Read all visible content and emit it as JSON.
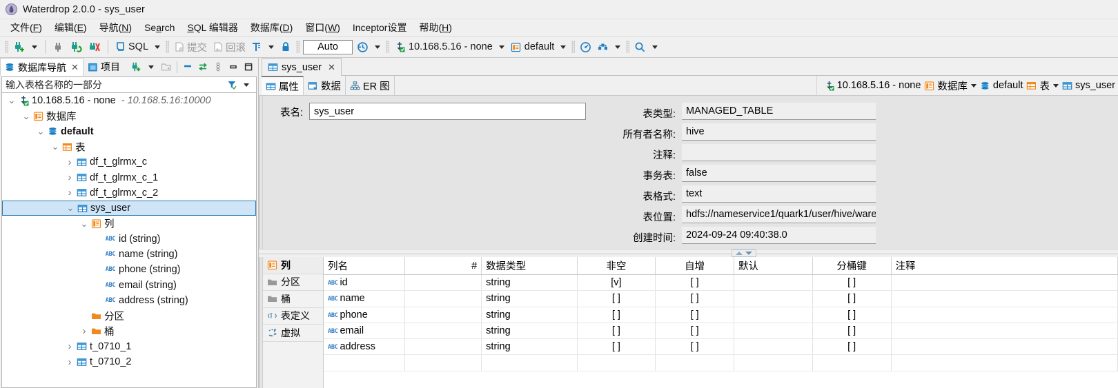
{
  "window": {
    "title": "Waterdrop 2.0.0 - sys_user",
    "icon": "waterdrop-icon",
    "minimize_label": "—",
    "maximize_label": "▣"
  },
  "menubar": {
    "items": [
      {
        "text": "文件(F)",
        "mnemonic": "F"
      },
      {
        "text": "编辑(E)",
        "mnemonic": "E"
      },
      {
        "text": "导航(N)",
        "mnemonic": "N"
      },
      {
        "text": "Search",
        "mnemonic": "a"
      },
      {
        "text": "SQL 编辑器",
        "mnemonic": "S"
      },
      {
        "text": "数据库(D)",
        "mnemonic": "D"
      },
      {
        "text": "窗口(W)",
        "mnemonic": "W"
      },
      {
        "text": "Inceptor设置",
        "mnemonic": ""
      },
      {
        "text": "帮助(H)",
        "mnemonic": "H"
      }
    ]
  },
  "toolbar": {
    "new_connection_label": "new-connection",
    "disconnect_label": "disconnect",
    "reconnect_label": "reconnect",
    "invalidate_label": "invalidate",
    "sql_label": "SQL",
    "commit_label": "提交",
    "rollback_label": "回滚",
    "transaction_mode_label": "transaction-mode",
    "lock_label": "lock",
    "auto_value": "Auto",
    "history_label": "history",
    "connection_value": "10.168.5.16 - none",
    "schema_value": "default",
    "dashboard_label": "dashboard",
    "tools_label": "tools",
    "search_label": "search"
  },
  "left_panel": {
    "tabs": [
      {
        "label": "数据库导航",
        "icon": "database-navigator-icon",
        "active": true,
        "closable": true
      },
      {
        "label": "项目",
        "icon": "project-icon",
        "active": false,
        "closable": false
      }
    ],
    "tools": [
      "new-connection-icon",
      "chevron-down-icon",
      "new-folder-icon",
      "collapse-all-icon",
      "link-editor-icon",
      "menu-icon",
      "minimize-icon",
      "maximize-icon"
    ],
    "filter": {
      "placeholder": "输入表格名称的一部分",
      "value": "",
      "filter_icon": "filter-icon",
      "chevron": "chevron-down-icon"
    },
    "tree": [
      {
        "indent": 0,
        "twist": "v",
        "icon": "connection-icon",
        "label": "10.168.5.16 - none",
        "sub": "10.168.5.16:10000",
        "bold": false,
        "selected": false
      },
      {
        "indent": 1,
        "twist": "v",
        "icon": "folder-db-icon",
        "label": "数据库",
        "sub": "",
        "bold": false,
        "selected": false
      },
      {
        "indent": 2,
        "twist": "v",
        "icon": "schema-icon",
        "label": "default",
        "sub": "",
        "bold": true,
        "selected": false
      },
      {
        "indent": 3,
        "twist": "v",
        "icon": "tables-folder-icon",
        "label": "表",
        "sub": "",
        "bold": false,
        "selected": false
      },
      {
        "indent": 4,
        "twist": ">",
        "icon": "table-icon",
        "label": "df_t_glrmx_c",
        "sub": "",
        "bold": false,
        "selected": false
      },
      {
        "indent": 4,
        "twist": ">",
        "icon": "table-icon",
        "label": "df_t_glrmx_c_1",
        "sub": "",
        "bold": false,
        "selected": false
      },
      {
        "indent": 4,
        "twist": ">",
        "icon": "table-icon",
        "label": "df_t_glrmx_c_2",
        "sub": "",
        "bold": false,
        "selected": false
      },
      {
        "indent": 4,
        "twist": "v",
        "icon": "table-icon",
        "label": "sys_user",
        "sub": "",
        "bold": false,
        "selected": true
      },
      {
        "indent": 5,
        "twist": "v",
        "icon": "columns-folder-icon",
        "label": "列",
        "sub": "",
        "bold": false,
        "selected": false
      },
      {
        "indent": 6,
        "twist": "",
        "icon": "abc-icon",
        "label": "id (string)",
        "sub": "",
        "bold": false,
        "selected": false
      },
      {
        "indent": 6,
        "twist": "",
        "icon": "abc-icon",
        "label": "name (string)",
        "sub": "",
        "bold": false,
        "selected": false
      },
      {
        "indent": 6,
        "twist": "",
        "icon": "abc-icon",
        "label": "phone (string)",
        "sub": "",
        "bold": false,
        "selected": false
      },
      {
        "indent": 6,
        "twist": "",
        "icon": "abc-icon",
        "label": "email (string)",
        "sub": "",
        "bold": false,
        "selected": false
      },
      {
        "indent": 6,
        "twist": "",
        "icon": "abc-icon",
        "label": "address (string)",
        "sub": "",
        "bold": false,
        "selected": false
      },
      {
        "indent": 5,
        "twist": "",
        "icon": "folder-icon",
        "label": "分区",
        "sub": "",
        "bold": false,
        "selected": false
      },
      {
        "indent": 5,
        "twist": ">",
        "icon": "folder-icon",
        "label": "桶",
        "sub": "",
        "bold": false,
        "selected": false
      },
      {
        "indent": 4,
        "twist": ">",
        "icon": "table-icon",
        "label": "t_0710_1",
        "sub": "",
        "bold": false,
        "selected": false
      },
      {
        "indent": 4,
        "twist": ">",
        "icon": "table-icon",
        "label": "t_0710_2",
        "sub": "",
        "bold": false,
        "selected": false
      }
    ]
  },
  "editor": {
    "tabs": [
      {
        "label": "sys_user",
        "icon": "table-icon",
        "active": true,
        "close": "×"
      }
    ],
    "subtabs": [
      {
        "label": "属性",
        "icon": "properties-icon",
        "active": true
      },
      {
        "label": "数据",
        "icon": "data-icon",
        "active": false
      },
      {
        "label": "ER 图",
        "icon": "er-diagram-icon",
        "active": false
      }
    ],
    "breadcrumb": [
      {
        "label": "10.168.5.16 - none",
        "icon": "connection-icon",
        "caret": false
      },
      {
        "label": "数据库",
        "icon": "folder-db-icon",
        "caret": true
      },
      {
        "label": "default",
        "icon": "schema-icon",
        "caret": false
      },
      {
        "label": "表",
        "icon": "tables-folder-icon",
        "caret": true
      },
      {
        "label": "sys_user",
        "icon": "table-icon",
        "caret": false
      }
    ]
  },
  "properties": {
    "left": {
      "label": "表名:",
      "value": "sys_user"
    },
    "right_rows": [
      {
        "label": "表类型:",
        "value": "MANAGED_TABLE"
      },
      {
        "label": "所有者名称:",
        "value": "hive"
      },
      {
        "label": "注释:",
        "value": ""
      },
      {
        "label": "事务表:",
        "value": "false"
      },
      {
        "label": "表格式:",
        "value": "text"
      },
      {
        "label": "表位置:",
        "value": "hdfs://nameservice1/quark1/user/hive/ware"
      },
      {
        "label": "创建时间:",
        "value": "2024-09-24 09:40:38.0"
      }
    ]
  },
  "sash": {
    "up_label": "restore-up",
    "down_label": "restore-down"
  },
  "grid": {
    "side_tabs": [
      {
        "label": "列",
        "icon": "columns-icon",
        "active": true
      },
      {
        "label": "分区",
        "icon": "folder-icon",
        "active": false
      },
      {
        "label": "桶",
        "icon": "folder-icon",
        "active": false
      },
      {
        "label": "表定义",
        "icon": "table-definition-icon",
        "active": false
      },
      {
        "label": "虚拟",
        "icon": "virtual-icon",
        "active": false
      }
    ],
    "columns": [
      "列名",
      "#",
      "数据类型",
      "非空",
      "自增",
      "默认",
      "分桶键",
      "注释"
    ],
    "rows": [
      {
        "name": "id",
        "num": "",
        "type": "string",
        "notnull": "[v]",
        "autoinc": "[ ]",
        "default": "",
        "bucketkey": "[ ]",
        "comment": ""
      },
      {
        "name": "name",
        "num": "",
        "type": "string",
        "notnull": "[ ]",
        "autoinc": "[ ]",
        "default": "",
        "bucketkey": "[ ]",
        "comment": ""
      },
      {
        "name": "phone",
        "num": "",
        "type": "string",
        "notnull": "[ ]",
        "autoinc": "[ ]",
        "default": "",
        "bucketkey": "[ ]",
        "comment": ""
      },
      {
        "name": "email",
        "num": "",
        "type": "string",
        "notnull": "[ ]",
        "autoinc": "[ ]",
        "default": "",
        "bucketkey": "[ ]",
        "comment": ""
      },
      {
        "name": "address",
        "num": "",
        "type": "string",
        "notnull": "[ ]",
        "autoinc": "[ ]",
        "default": "",
        "bucketkey": "[ ]",
        "comment": ""
      }
    ]
  },
  "colors": {
    "accent_blue": "#1f7fc4",
    "orange": "#f08a1e",
    "selection": "#cfe4f7",
    "chrome": "#f0f0f0"
  }
}
